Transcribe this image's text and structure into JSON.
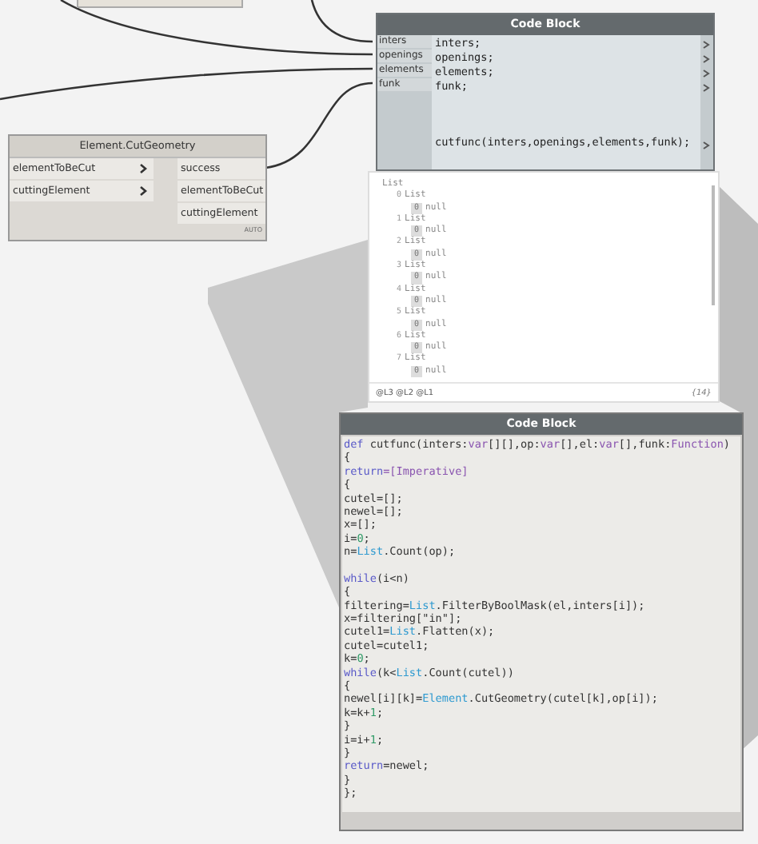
{
  "code_block_top": {
    "title": "Code Block",
    "inputs": [
      {
        "name": "inters",
        "line": "inters;"
      },
      {
        "name": "openings",
        "line": "openings;"
      },
      {
        "name": "elements",
        "line": "elements;"
      },
      {
        "name": "funk",
        "line": "funk;"
      }
    ],
    "result_line": "cutfunc(inters,openings,elements,funk);"
  },
  "cut_geometry_node": {
    "title": "Element.CutGeometry",
    "inputs": [
      "elementToBeCut",
      "cuttingElement"
    ],
    "outputs": [
      "success",
      "elementToBeCut",
      "cuttingElement"
    ],
    "lacing": "AUTO"
  },
  "watch": {
    "root": {
      "label": "List",
      "children": [
        {
          "index": "0",
          "label": "List",
          "children": [
            {
              "index": "0",
              "label": "null"
            }
          ]
        },
        {
          "index": "1",
          "label": "List",
          "children": [
            {
              "index": "0",
              "label": "null"
            }
          ]
        },
        {
          "index": "2",
          "label": "List",
          "children": [
            {
              "index": "0",
              "label": "null"
            }
          ]
        },
        {
          "index": "3",
          "label": "List",
          "children": [
            {
              "index": "0",
              "label": "null"
            }
          ]
        },
        {
          "index": "4",
          "label": "List",
          "children": [
            {
              "index": "0",
              "label": "null"
            }
          ]
        },
        {
          "index": "5",
          "label": "List",
          "children": [
            {
              "index": "0",
              "label": "null"
            }
          ]
        },
        {
          "index": "6",
          "label": "List",
          "children": [
            {
              "index": "0",
              "label": "null"
            }
          ]
        },
        {
          "index": "7",
          "label": "List",
          "children": [
            {
              "index": "0",
              "label": "null"
            }
          ]
        }
      ]
    },
    "levels": "@L3 @L2 @L1",
    "count": "{14}"
  },
  "code_block_main": {
    "title": "Code Block",
    "lines": [
      {
        "segments": [
          {
            "t": "def ",
            "kind": "kw"
          },
          {
            "t": "cutfunc(inters:",
            "kind": "plain"
          },
          {
            "t": "var",
            "kind": "type"
          },
          {
            "t": "[][],op:",
            "kind": "plain"
          },
          {
            "t": "var",
            "kind": "type"
          },
          {
            "t": "[],el:",
            "kind": "plain"
          },
          {
            "t": "var",
            "kind": "type"
          },
          {
            "t": "[],funk:",
            "kind": "plain"
          },
          {
            "t": "Function",
            "kind": "type"
          },
          {
            "t": ")",
            "kind": "plain"
          }
        ]
      },
      {
        "segments": [
          {
            "t": "{",
            "kind": "plain"
          }
        ]
      },
      {
        "segments": [
          {
            "t": "return",
            "kind": "kw"
          },
          {
            "t": "=[Imperative]",
            "kind": "type"
          }
        ]
      },
      {
        "segments": [
          {
            "t": "{",
            "kind": "plain"
          }
        ]
      },
      {
        "segments": [
          {
            "t": "cutel=[];",
            "kind": "plain"
          }
        ]
      },
      {
        "segments": [
          {
            "t": "newel=[];",
            "kind": "plain"
          }
        ]
      },
      {
        "segments": [
          {
            "t": "x=[];",
            "kind": "plain"
          }
        ]
      },
      {
        "segments": [
          {
            "t": "i=",
            "kind": "plain"
          },
          {
            "t": "0",
            "kind": "num"
          },
          {
            "t": ";",
            "kind": "plain"
          }
        ]
      },
      {
        "segments": [
          {
            "t": "n=",
            "kind": "plain"
          },
          {
            "t": "List",
            "kind": "cls"
          },
          {
            "t": ".Count(op);",
            "kind": "plain"
          }
        ]
      },
      {
        "gap_before": true,
        "segments": [
          {
            "t": "while",
            "kind": "kw"
          },
          {
            "t": "(i<n)",
            "kind": "plain"
          }
        ]
      },
      {
        "segments": [
          {
            "t": "{",
            "kind": "plain"
          }
        ]
      },
      {
        "segments": [
          {
            "t": "filtering=",
            "kind": "plain"
          },
          {
            "t": "List",
            "kind": "cls"
          },
          {
            "t": ".FilterByBoolMask(el,inters[i]);",
            "kind": "plain"
          }
        ]
      },
      {
        "segments": [
          {
            "t": "x=filtering[\"in\"];",
            "kind": "plain"
          }
        ]
      },
      {
        "segments": [
          {
            "t": "cutel1=",
            "kind": "plain"
          },
          {
            "t": "List",
            "kind": "cls"
          },
          {
            "t": ".Flatten(x);",
            "kind": "plain"
          }
        ]
      },
      {
        "segments": [
          {
            "t": "cutel=cutel1;",
            "kind": "plain"
          }
        ]
      },
      {
        "segments": [
          {
            "t": "k=",
            "kind": "plain"
          },
          {
            "t": "0",
            "kind": "num"
          },
          {
            "t": ";",
            "kind": "plain"
          }
        ]
      },
      {
        "segments": [
          {
            "t": "while",
            "kind": "kw"
          },
          {
            "t": "(k<",
            "kind": "plain"
          },
          {
            "t": "List",
            "kind": "cls"
          },
          {
            "t": ".Count(cutel))",
            "kind": "plain"
          }
        ]
      },
      {
        "segments": [
          {
            "t": "{",
            "kind": "plain"
          }
        ]
      },
      {
        "segments": [
          {
            "t": "newel[i][k]=",
            "kind": "plain"
          },
          {
            "t": "Element",
            "kind": "cls"
          },
          {
            "t": ".CutGeometry(cutel[k],op[i]);",
            "kind": "plain"
          }
        ]
      },
      {
        "segments": [
          {
            "t": "k=k+",
            "kind": "plain"
          },
          {
            "t": "1",
            "kind": "num"
          },
          {
            "t": ";",
            "kind": "plain"
          }
        ]
      },
      {
        "segments": [
          {
            "t": "}",
            "kind": "plain"
          }
        ]
      },
      {
        "segments": [
          {
            "t": "i=i+",
            "kind": "plain"
          },
          {
            "t": "1",
            "kind": "num"
          },
          {
            "t": ";",
            "kind": "plain"
          }
        ]
      },
      {
        "segments": [
          {
            "t": "}",
            "kind": "plain"
          }
        ]
      },
      {
        "segments": [
          {
            "t": "return",
            "kind": "kw"
          },
          {
            "t": "=newel;",
            "kind": "plain"
          }
        ]
      },
      {
        "segments": [
          {
            "t": "}",
            "kind": "plain"
          }
        ]
      },
      {
        "segments": [
          {
            "t": "};",
            "kind": "plain"
          }
        ]
      }
    ]
  }
}
